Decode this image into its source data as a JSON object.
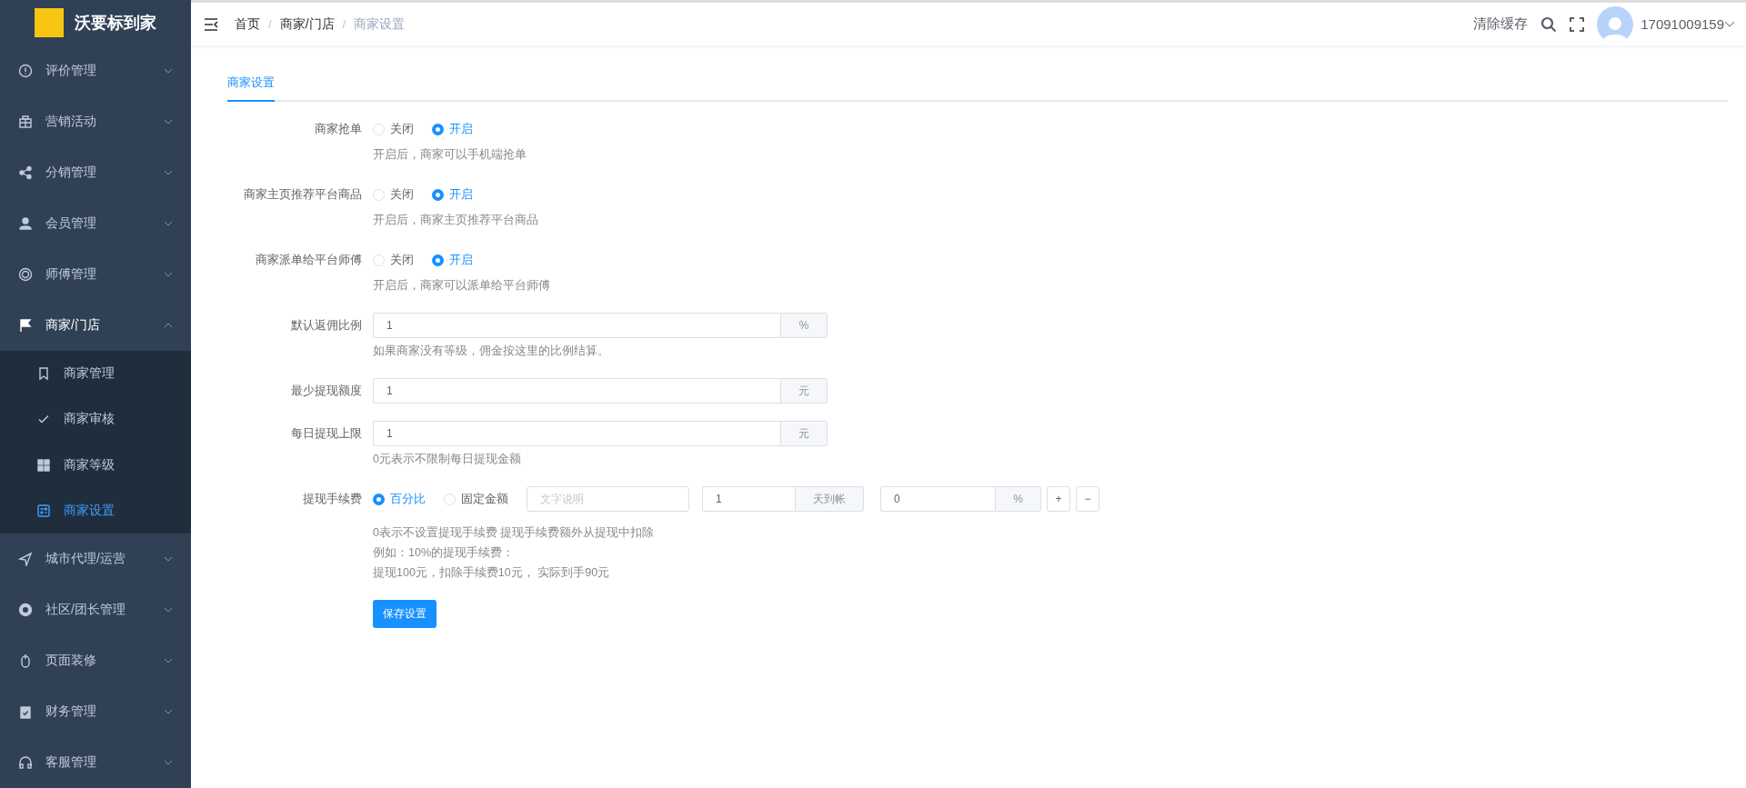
{
  "brand": {
    "name": "沃要标到家"
  },
  "sidebar": {
    "items": [
      {
        "label": "评价管理",
        "expanded": false
      },
      {
        "label": "营销活动",
        "expanded": false
      },
      {
        "label": "分销管理",
        "expanded": false
      },
      {
        "label": "会员管理",
        "expanded": false
      },
      {
        "label": "师傅管理",
        "expanded": false
      },
      {
        "label": "商家/门店",
        "expanded": true,
        "children": [
          {
            "label": "商家管理",
            "selected": false
          },
          {
            "label": "商家审核",
            "selected": false
          },
          {
            "label": "商家等级",
            "selected": false
          },
          {
            "label": "商家设置",
            "selected": true
          }
        ]
      },
      {
        "label": "城市代理/运营",
        "expanded": false
      },
      {
        "label": "社区/团长管理",
        "expanded": false
      },
      {
        "label": "页面装修",
        "expanded": false
      },
      {
        "label": "财务管理",
        "expanded": false
      },
      {
        "label": "客服管理",
        "expanded": false
      }
    ]
  },
  "breadcrumb": {
    "separator": "/",
    "items": [
      "首页",
      "商家/门店",
      "商家设置"
    ]
  },
  "header": {
    "clear_cache": "清除缓存",
    "username": "17091009159"
  },
  "tabs": [
    {
      "label": "商家设置",
      "selected": true
    }
  ],
  "form": {
    "rows": [
      {
        "kind": "radio",
        "label": "商家抢单",
        "options": [
          {
            "label": "关闭",
            "selected": false
          },
          {
            "label": "开启",
            "selected": true
          }
        ],
        "help": [
          "开启后，商家可以手机端抢单"
        ]
      },
      {
        "kind": "radio",
        "label": "商家主页推荐平台商品",
        "options": [
          {
            "label": "关闭",
            "selected": false
          },
          {
            "label": "开启",
            "selected": true
          }
        ],
        "help": [
          "开启后，商家主页推荐平台商品"
        ]
      },
      {
        "kind": "radio",
        "label": "商家派单给平台师傅",
        "options": [
          {
            "label": "关闭",
            "selected": false
          },
          {
            "label": "开启",
            "selected": true
          }
        ],
        "help": [
          "开启后，商家可以派单给平台师傅"
        ]
      },
      {
        "kind": "input",
        "label": "默认返佣比例",
        "value": "1",
        "unit": "%",
        "help": [
          "如果商家没有等级，佣金按这里的比例结算。"
        ]
      },
      {
        "kind": "input",
        "label": "最少提现额度",
        "value": "1",
        "unit": "元"
      },
      {
        "kind": "input",
        "label": "每日提现上限",
        "value": "1",
        "unit": "元",
        "help": [
          "0元表示不限制每日提现金额"
        ]
      },
      {
        "kind": "fee",
        "label": "提现手续费",
        "options": [
          {
            "label": "百分比",
            "selected": true
          },
          {
            "label": "固定金额",
            "selected": false
          }
        ],
        "note_placeholder": "文字说明",
        "days": {
          "value": "1",
          "unit": "天到帐"
        },
        "rate": {
          "value": "0",
          "unit": "%"
        },
        "add": "+",
        "remove": "−",
        "help": [
          "0表示不设置提现手续费 提现手续费额外从提现中扣除",
          "例如：10%的提现手续费：",
          "提现100元，扣除手续费10元， 实际到手90元"
        ]
      }
    ],
    "submit": "保存设置"
  }
}
